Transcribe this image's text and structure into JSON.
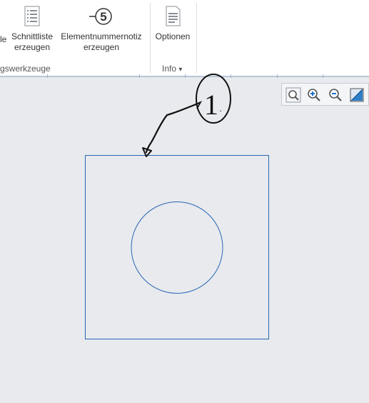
{
  "ribbon": {
    "cut_left_label": "le",
    "section_list": {
      "line1": "Schnittliste",
      "line2": "erzeugen",
      "icon": "list-document-icon"
    },
    "element_number": {
      "line1": "Elementnummernotiz",
      "line2": "erzeugen",
      "icon": "numbered-balloon-icon",
      "glyph": "5"
    },
    "options": {
      "label": "Optionen",
      "icon": "settings-document-icon"
    },
    "group_tools_label": "gswerkzeuge",
    "group_info_label": "Info",
    "group_info_arrow": "▾"
  },
  "view_toolbar": {
    "items": [
      "zoom-fit-icon",
      "zoom-in-icon",
      "zoom-out-icon",
      "display-style-icon"
    ]
  },
  "drawing": {
    "annotation_text": "1",
    "annotation_dot": "."
  },
  "colors": {
    "canvas": "#e8eaee",
    "geometry": "#2a66b2",
    "ink": "#111111",
    "accent": "#1e6fd0"
  }
}
